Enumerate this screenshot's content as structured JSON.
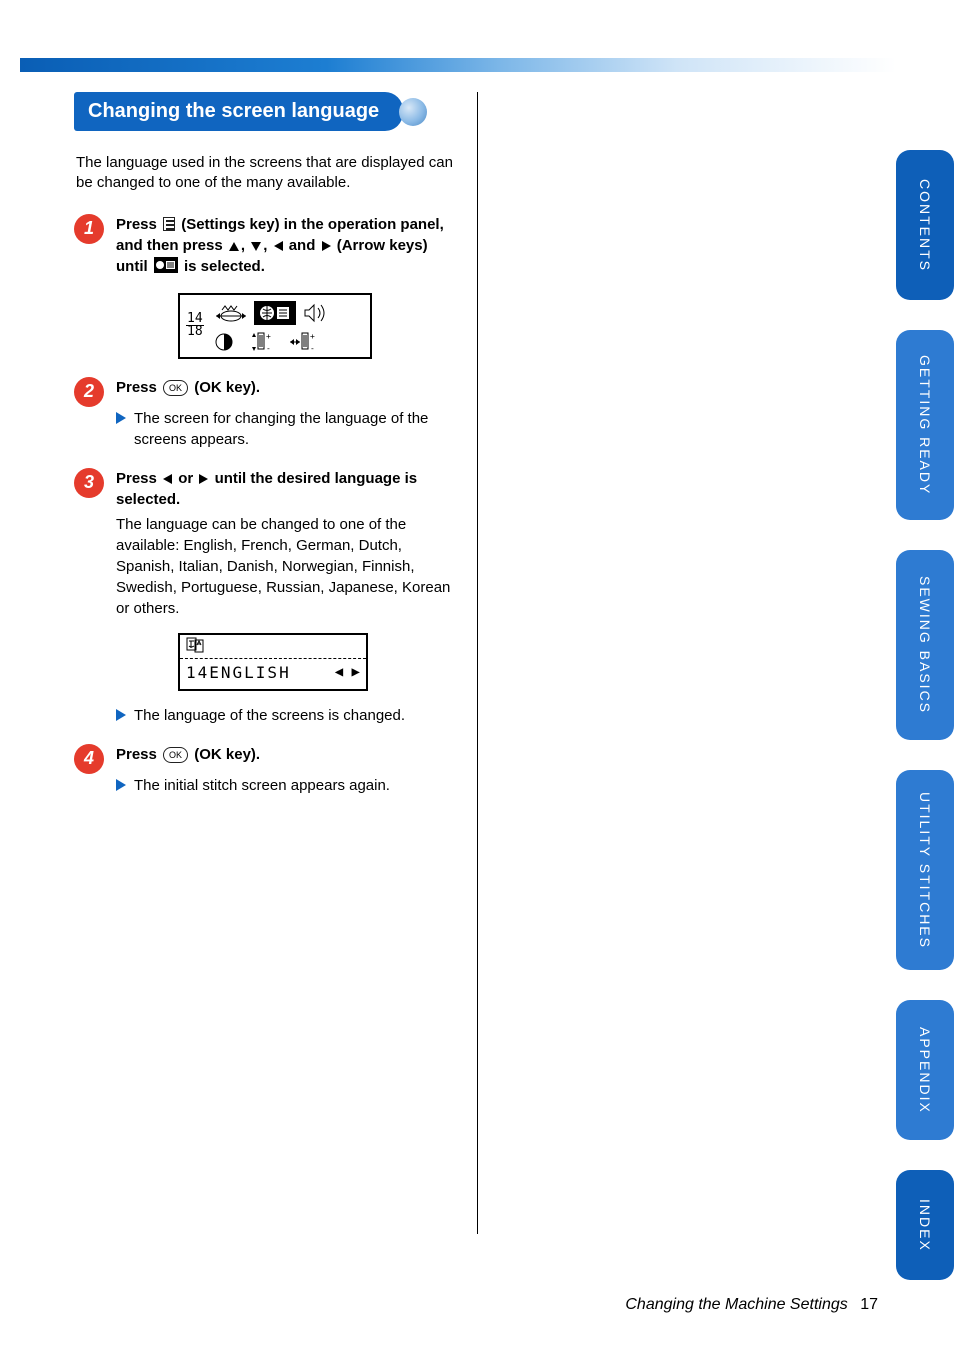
{
  "section_title": "Changing the screen language",
  "intro": "The language used in the screens that are displayed can be changed to one of the many available.",
  "steps": {
    "s1": {
      "num": "1",
      "title_a": "Press ",
      "title_b": " (Settings key) in the operation panel, and then press ",
      "title_c": " and ",
      "title_d": " (Arrow keys) until ",
      "title_e": " is selected."
    },
    "s2": {
      "num": "2",
      "title_a": "Press ",
      "title_b": " (OK key).",
      "result": "The screen for changing the language of the screens appears."
    },
    "s3": {
      "num": "3",
      "title_a": "Press ",
      "title_b": " or ",
      "title_c": " until the desired language is selected.",
      "body": "The language can be changed to one of the available: English, French, German, Dutch, Spanish, Italian, Danish, Norwegian, Finnish, Swedish, Portuguese, Russian, Japanese, Korean or others.",
      "result": "The language of the screens is changed."
    },
    "s4": {
      "num": "4",
      "title_a": "Press ",
      "title_b": " (OK key).",
      "result": "The initial stitch screen appears again."
    }
  },
  "screen1": {
    "frac_num": "14",
    "frac_den": "18"
  },
  "screen2": {
    "line": "14ENGLISH",
    "arrows": "◀ ▶"
  },
  "tabs": {
    "t1": "CONTENTS",
    "t2": "GETTING READY",
    "t3": "SEWING BASICS",
    "t4": "UTILITY STITCHES",
    "t5": "APPENDIX",
    "t6": "INDEX"
  },
  "footer": {
    "title": "Changing the Machine Settings",
    "page": "17"
  },
  "ok_label": "OK"
}
